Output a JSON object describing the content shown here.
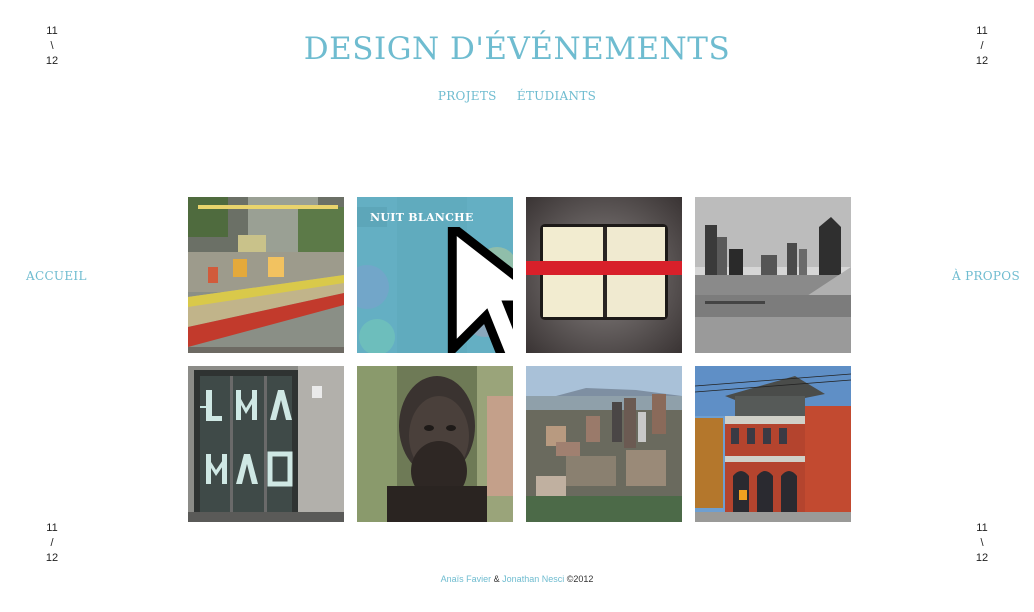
{
  "site": {
    "title": "DESIGN D'ÉVÉNEMENTS"
  },
  "nav": {
    "projects": "PROJETS",
    "students": "ÉTUDIANTS",
    "home": "ACCUEIL",
    "about": "À PROPOS"
  },
  "corners": {
    "top_left": {
      "top": "11",
      "sep": "\\",
      "bottom": "12"
    },
    "top_right": {
      "top": "11",
      "sep": "/",
      "bottom": "12"
    },
    "bottom_left": {
      "top": "11",
      "sep": "/",
      "bottom": "12"
    },
    "bottom_right": {
      "top": "11",
      "sep": "\\",
      "bottom": "12"
    }
  },
  "projects": {
    "hovered_label": "NUIT BLANCHE",
    "hover_color": "#6fbcd0"
  },
  "footer": {
    "author1": "Anaïs Favier",
    "amp": " & ",
    "author2": "Jonathan Nesci",
    "copyright": " ©2012"
  },
  "colors": {
    "accent": "#6fbcd0",
    "text": "#222222",
    "background": "#ffffff"
  }
}
